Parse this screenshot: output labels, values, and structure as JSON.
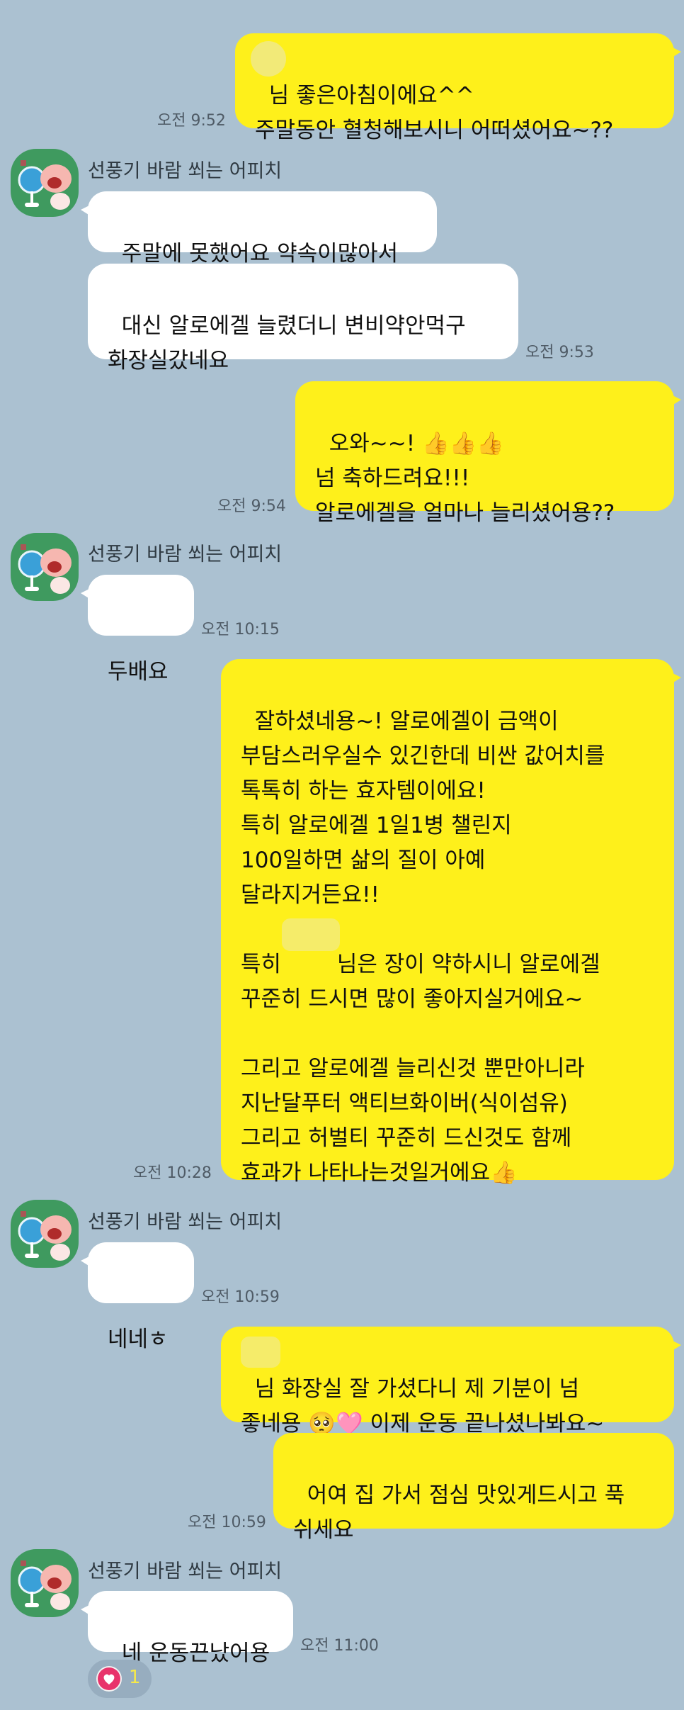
{
  "chat": {
    "sender_name": "선풍기 바람 쐬는 어피치",
    "messages": [
      {
        "from": "me",
        "text": "님 좋은아침이에요^^\n주말동안 혈청해보시니 어떠셨어요~??",
        "time": "오전 9:52"
      },
      {
        "from": "them",
        "text": "주말에 못했어요 약속이많아서"
      },
      {
        "from": "them",
        "text": "대신 알로에겔 늘렸더니 변비약안먹구\n화장실갔네요",
        "time": "오전 9:53"
      },
      {
        "from": "me",
        "text": "오와~~! 👍👍👍\n넘 축하드려요!!!\n알로에겔을 얼마나 늘리셨어용??",
        "time": "오전 9:54"
      },
      {
        "from": "them",
        "text": "두배요",
        "time": "오전 10:15"
      },
      {
        "from": "me",
        "text": "잘하셨네용~! 알로에겔이 금액이\n부담스러우실수 있긴한데 비싼 값어치를\n톡톡히 하는 효자템이에요!\n특히 알로에겔 1일1병 챌린지\n100일하면 삶의 질이 아예\n달라지거든요!!\n\n특히        님은 장이 약하시니 알로에겔\n꾸준히 드시면 많이 좋아지실거에요~\n\n그리고 알로에겔 늘리신것 뿐만아니라\n지난달푸터 액티브화이버(식이섬유)\n그리고 허벌티 꾸준히 드신것도 함께\n효과가 나타나는것일거에요👍",
        "time": "오전 10:28"
      },
      {
        "from": "them",
        "text": "네네ㅎ",
        "time": "오전 10:59"
      },
      {
        "from": "me",
        "text": "님 화장실 잘 가셨다니 제 기분이 넘\n좋네용 🥺🩷 이제 운동 끝나셨나봐요~"
      },
      {
        "from": "me",
        "text": "어여 집 가서 점심 맛있게드시고 푹\n쉬세요",
        "time": "오전 10:59"
      },
      {
        "from": "them",
        "text": "네 운동끈났어용",
        "time": "오전 11:00"
      }
    ],
    "reaction": {
      "icon": "heart-icon",
      "count": "1"
    }
  },
  "colors": {
    "background": "#abc1d1",
    "my_bubble": "#fef01b",
    "their_bubble": "#ffffff",
    "avatar_bg": "#3f9a5f"
  }
}
